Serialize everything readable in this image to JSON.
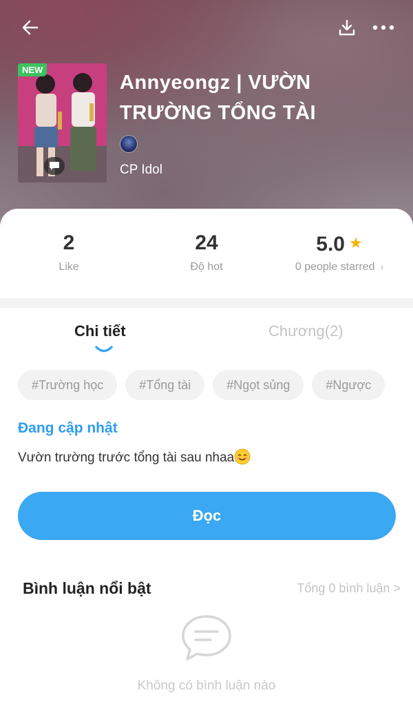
{
  "story": {
    "badge": "NEW",
    "title_line1": "Annyeongz | VƯỜN",
    "title_line2": "TRƯỜNG TỔNG TÀI",
    "category": "CP Idol"
  },
  "stats": {
    "likes": "2",
    "likes_label": "Like",
    "hot": "24",
    "hot_label": "Độ hot",
    "rating": "5.0",
    "rating_label": "0 people starred"
  },
  "tabs": {
    "detail": "Chi tiết",
    "chapters": "Chương(2)"
  },
  "tags": [
    "#Trường học",
    "#Tổng tài",
    "#Ngọt sủng",
    "#Ngược"
  ],
  "status": "Đang cập nhật",
  "description": "Vườn trường trước tổng tài sau nhaa",
  "read_button": "Đọc",
  "comments": {
    "title": "Bình luận nổi bật",
    "total": "Tổng 0 bình luận >",
    "empty": "Không có bình luận nào"
  },
  "icons": [
    "back-arrow-icon",
    "download-icon",
    "more-icon",
    "comment-icon",
    "star-icon",
    "smile-emoji-icon"
  ],
  "colors": {
    "accent": "#3aa8f2",
    "status": "#2e9ef0",
    "star": "#f5b400",
    "new_badge": "#3cc25f"
  }
}
